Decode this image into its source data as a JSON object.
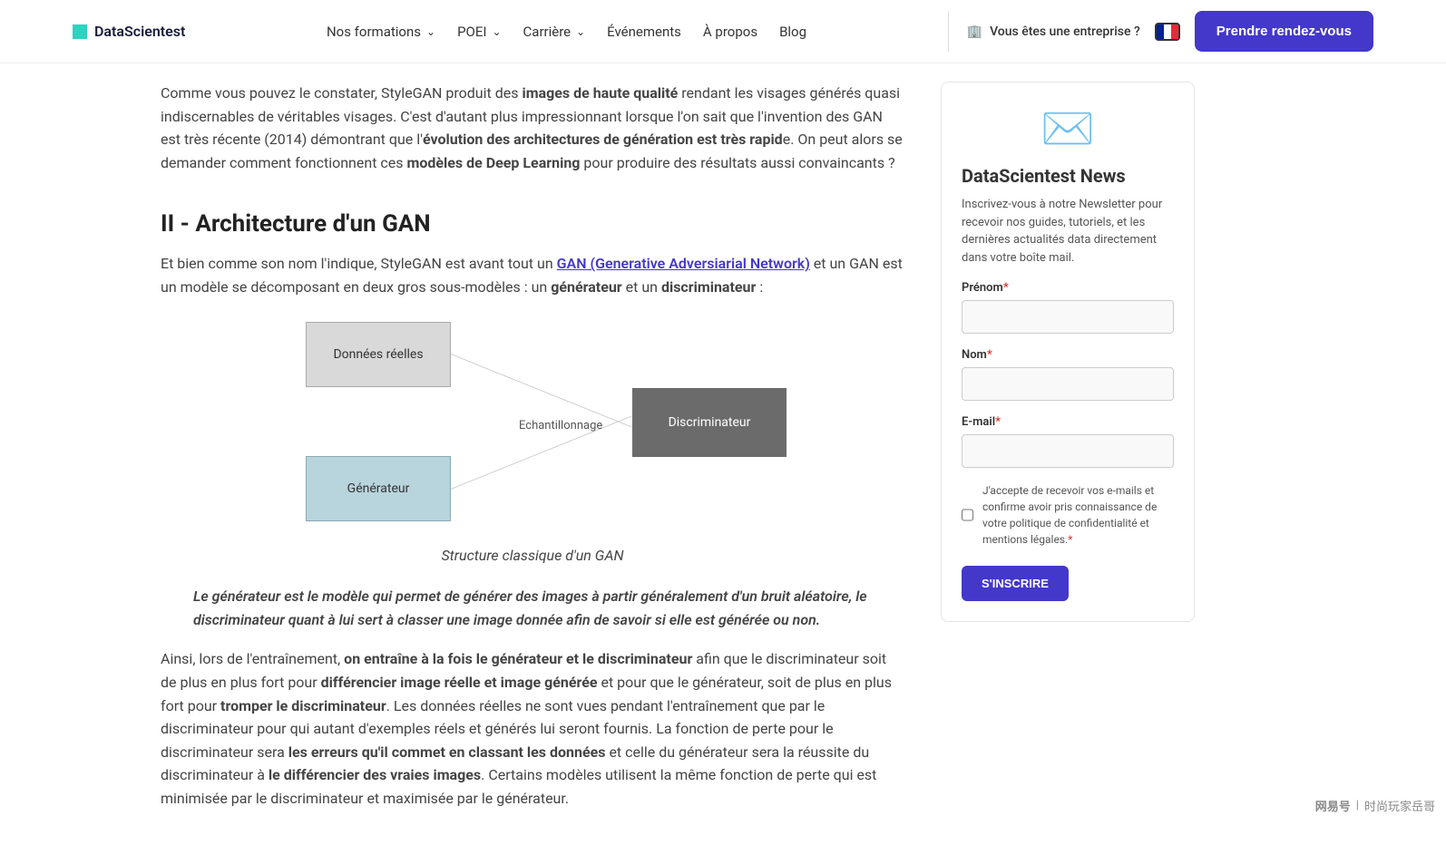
{
  "header": {
    "logo": "DataScientest",
    "nav": [
      {
        "label": "Nos formations",
        "dropdown": true
      },
      {
        "label": "POEI",
        "dropdown": true
      },
      {
        "label": "Carrière",
        "dropdown": true
      },
      {
        "label": "Événements",
        "dropdown": false
      },
      {
        "label": "À propos",
        "dropdown": false
      },
      {
        "label": "Blog",
        "dropdown": false
      }
    ],
    "enterprise": "Vous êtes une entreprise ?",
    "cta": "Prendre rendez-vous"
  },
  "article": {
    "p1_a": "Comme vous pouvez le constater, StyleGAN produit des ",
    "p1_b1": "images de haute qualité",
    "p1_c": " rendant les visages générés quasi indiscernables de véritables visages. C'est d'autant plus impressionnant lorsque l'on sait que l'invention des GAN est très récente (2014) démontrant que l'",
    "p1_b2": "évolution des architectures de génération est très rapid",
    "p1_d": "e. On peut alors se demander comment fonctionnent ces ",
    "p1_b3": "modèles de Deep Learning",
    "p1_e": " pour produire des résultats aussi convaincants ?",
    "h2": "II - Architecture d'un GAN",
    "p2_a": "Et bien comme son nom l'indique, StyleGAN est avant tout un ",
    "p2_link": "GAN (Generative Adversiarial Network)",
    "p2_b": " et un GAN est un modèle se décomposant en deux gros sous-modèles : un ",
    "p2_b1": "générateur",
    "p2_c": " et un ",
    "p2_b2": "discriminateur",
    "p2_d": " :",
    "diagram": {
      "data": "Données réelles",
      "gen": "Générateur",
      "disc": "Discriminateur",
      "sample": "Echantillonnage",
      "caption": "Structure classique d'un GAN"
    },
    "quote": "Le générateur est le modèle qui permet de générer des images à partir généralement d'un bruit aléatoire, le discriminateur quant à lui sert à classer une image donnée afin de savoir si elle est générée ou non.",
    "p3_a": "Ainsi, lors de l'entraînement, ",
    "p3_b1": "on entraîne à la fois le générateur et le discriminateur",
    "p3_b": " afin que le discriminateur soit de plus en plus fort pour ",
    "p3_b2": "différencier image réelle et image générée",
    "p3_c": " et pour que le générateur, soit de plus en plus fort pour ",
    "p3_b3": "tromper le discriminateur",
    "p3_d": ". Les données réelles ne sont vues pendant l'entraînement que par le discriminateur pour qui autant d'exemples réels et générés lui seront fournis. La fonction de perte pour le discriminateur sera ",
    "p3_b4": "les erreurs qu'il commet en classant les données",
    "p3_e": " et celle du générateur sera la réussite du discriminateur à ",
    "p3_b5": "le différencier des vraies images",
    "p3_f": ". Certains modèles utilisent la même fonction de perte qui est minimisée par le discriminateur et maximisée par le générateur."
  },
  "sidebar": {
    "title": "DataScientest News",
    "desc": "Inscrivez-vous à notre Newsletter pour recevoir nos guides, tutoriels, et les dernières actualités data directement dans votre boîte mail.",
    "prenom": "Prénom",
    "nom": "Nom",
    "email": "E-mail",
    "consent": "J'accepte de recevoir vos e-mails et confirme avoir pris connaissance de votre politique de confidentialité et mentions légales.",
    "submit": "S'INSCRIRE"
  },
  "footer": {
    "brand": "网易号",
    "author": "时尚玩家岳哥"
  }
}
